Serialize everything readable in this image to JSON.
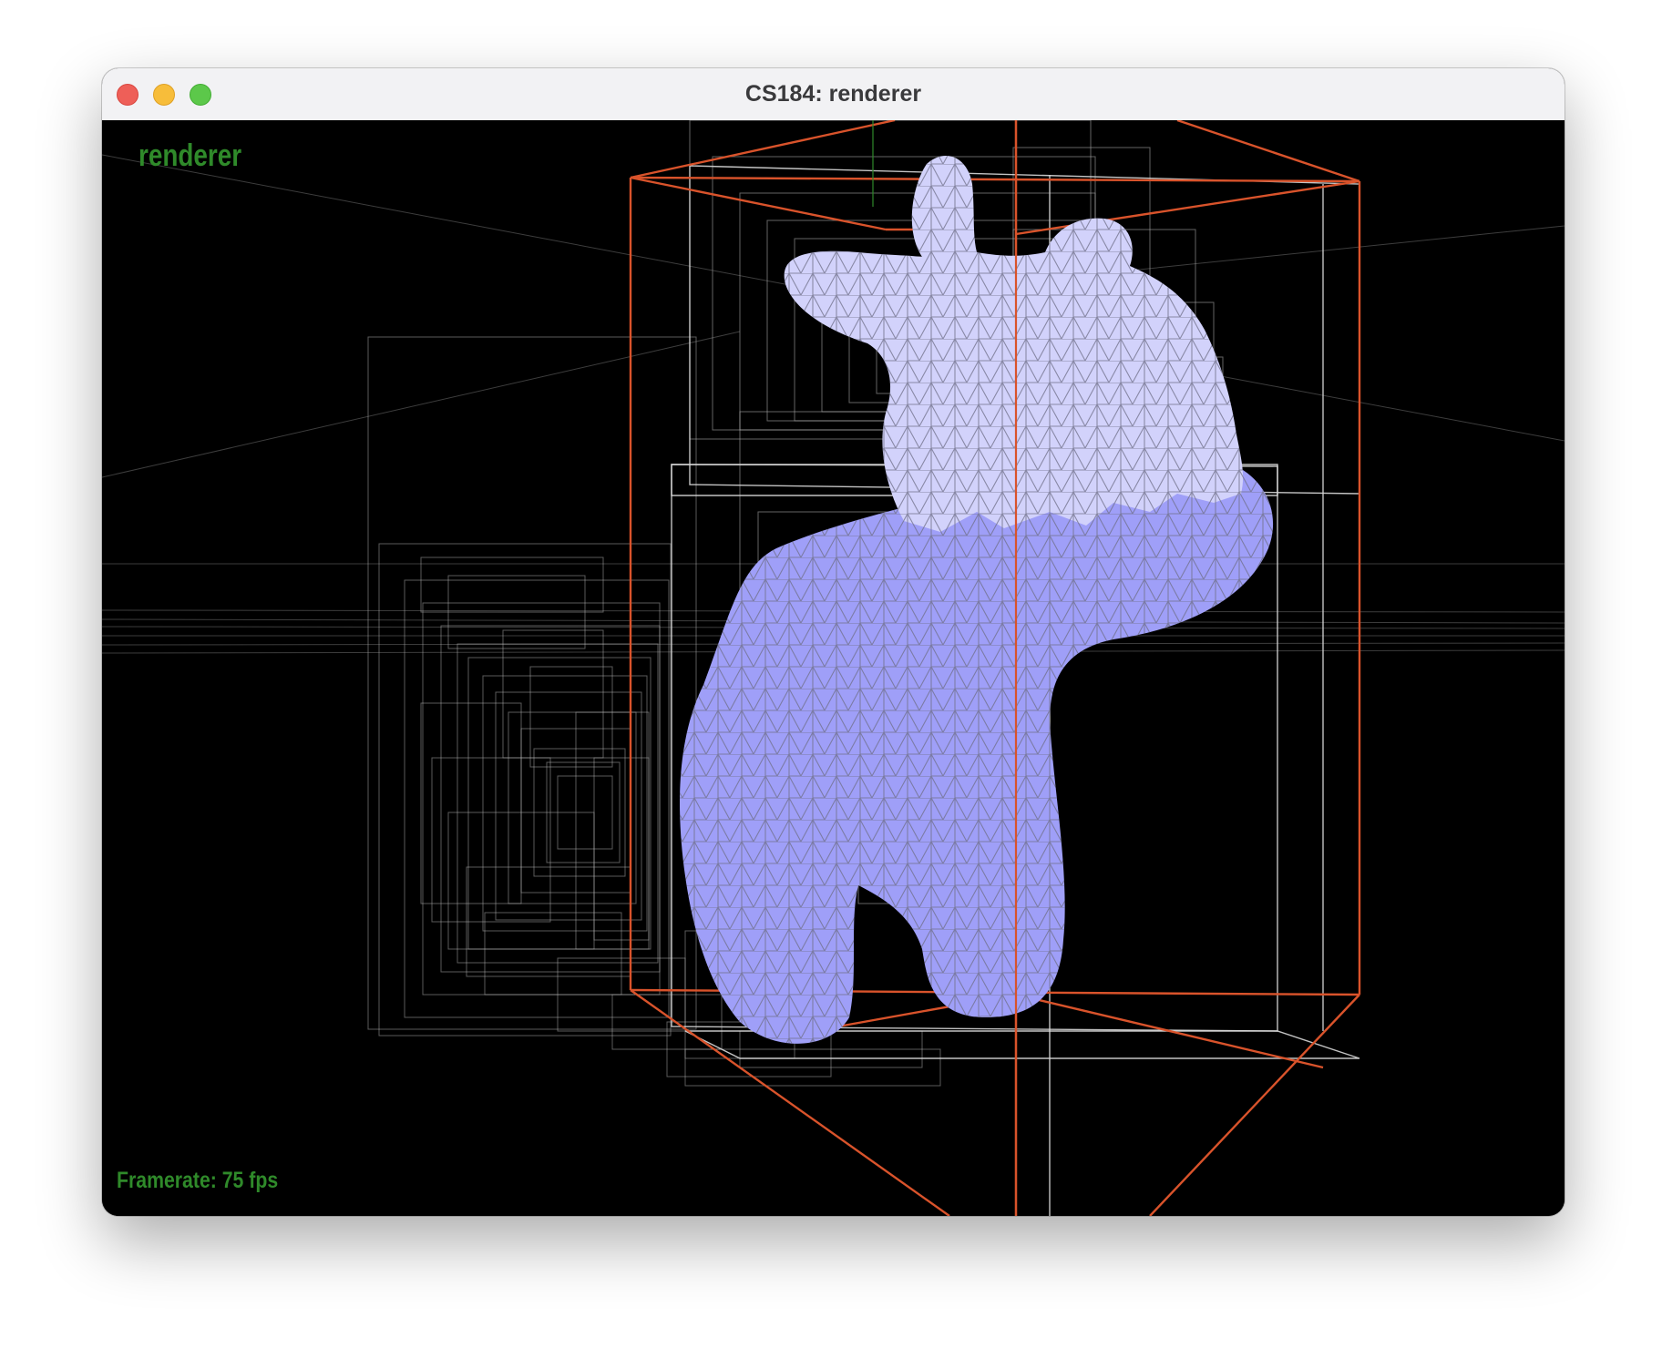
{
  "window": {
    "title": "CS184: renderer"
  },
  "viewport": {
    "app_label": "renderer",
    "framerate_label": "Framerate: 75 fps",
    "mesh_color": "#9f9ff8",
    "mesh_highlight_color": "#d2d2fb",
    "bbox_color": "#d9532b",
    "bvh_line_color": "#b4b4b4"
  }
}
